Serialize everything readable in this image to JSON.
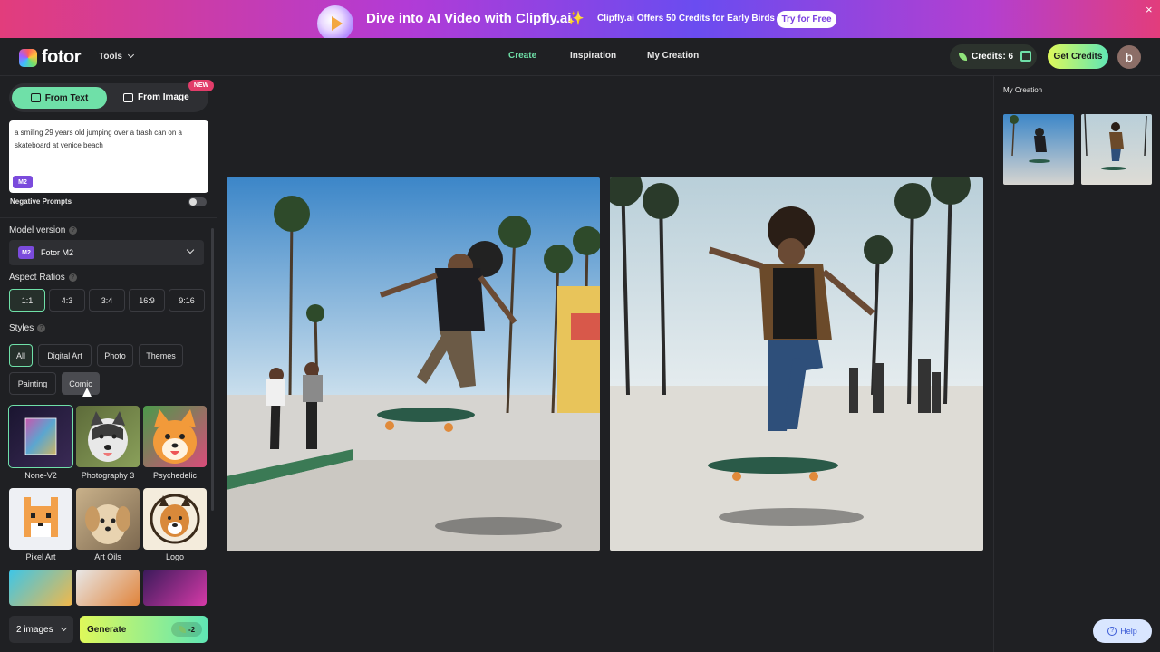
{
  "banner": {
    "title": "Dive into AI Video with Clipfly.ai",
    "sparkle": "✨",
    "subtitle": "Clipfly.ai Offers 50 Credits for Early Birds",
    "cta": "Try for Free",
    "close": "×"
  },
  "header": {
    "brand": "fotor",
    "tools": "Tools",
    "nav": [
      "Create",
      "Inspiration",
      "My Creation"
    ],
    "credits": "Credits: 6",
    "get_credits": "Get Credits",
    "avatar_letter": "b"
  },
  "left": {
    "tab_text": "From Text",
    "tab_image": "From Image",
    "new_badge": "NEW",
    "prompt": "a smiling 29 years old jumping over a trash can on a skateboard at venice beach",
    "prompt_badge": "M2",
    "negative_prompts": "Negative Prompts",
    "model_version_label": "Model version",
    "model_badge": "M2",
    "model_value": "Fotor M2",
    "aspect_label": "Aspect Ratios",
    "ratios": [
      "1:1",
      "4:3",
      "3:4",
      "16:9",
      "9:16"
    ],
    "styles_label": "Styles",
    "style_chips": [
      "All",
      "Digital Art",
      "Photo",
      "Themes",
      "Painting",
      "Comic"
    ],
    "style_cards": [
      "None-V2",
      "Photography 3",
      "Psychedelic",
      "Pixel Art",
      "Art Oils",
      "Logo"
    ],
    "count": "2 images",
    "generate": "Generate",
    "cost": "-2"
  },
  "right": {
    "title": "My Creation",
    "help": "Help"
  },
  "colors": {
    "accent": "#6fe0a8",
    "background": "#1f2023"
  }
}
